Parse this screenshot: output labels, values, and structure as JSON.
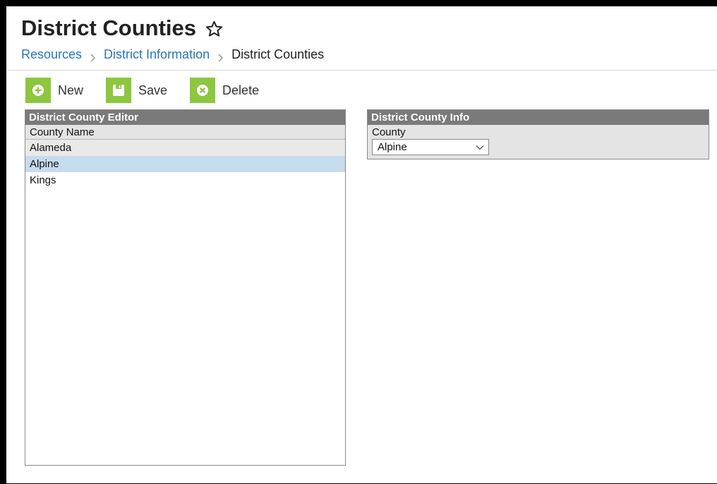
{
  "header": {
    "title": "District Counties",
    "breadcrumb": {
      "items": [
        {
          "label": "Resources"
        },
        {
          "label": "District Information"
        },
        {
          "label": "District Counties"
        }
      ]
    }
  },
  "toolbar": {
    "new_label": "New",
    "save_label": "Save",
    "delete_label": "Delete"
  },
  "editor": {
    "title": "District County Editor",
    "column_header": "County Name",
    "rows": [
      {
        "name": "Alameda"
      },
      {
        "name": "Alpine"
      },
      {
        "name": "Kings"
      }
    ],
    "selected": "Alpine"
  },
  "info": {
    "title": "District County Info",
    "county_label": "County",
    "county_value": "Alpine"
  },
  "colors": {
    "accent_green": "#8dc63f",
    "link_blue": "#2a76b5",
    "panel_header": "#7a7a7a",
    "selected_row": "#c6dbee"
  }
}
